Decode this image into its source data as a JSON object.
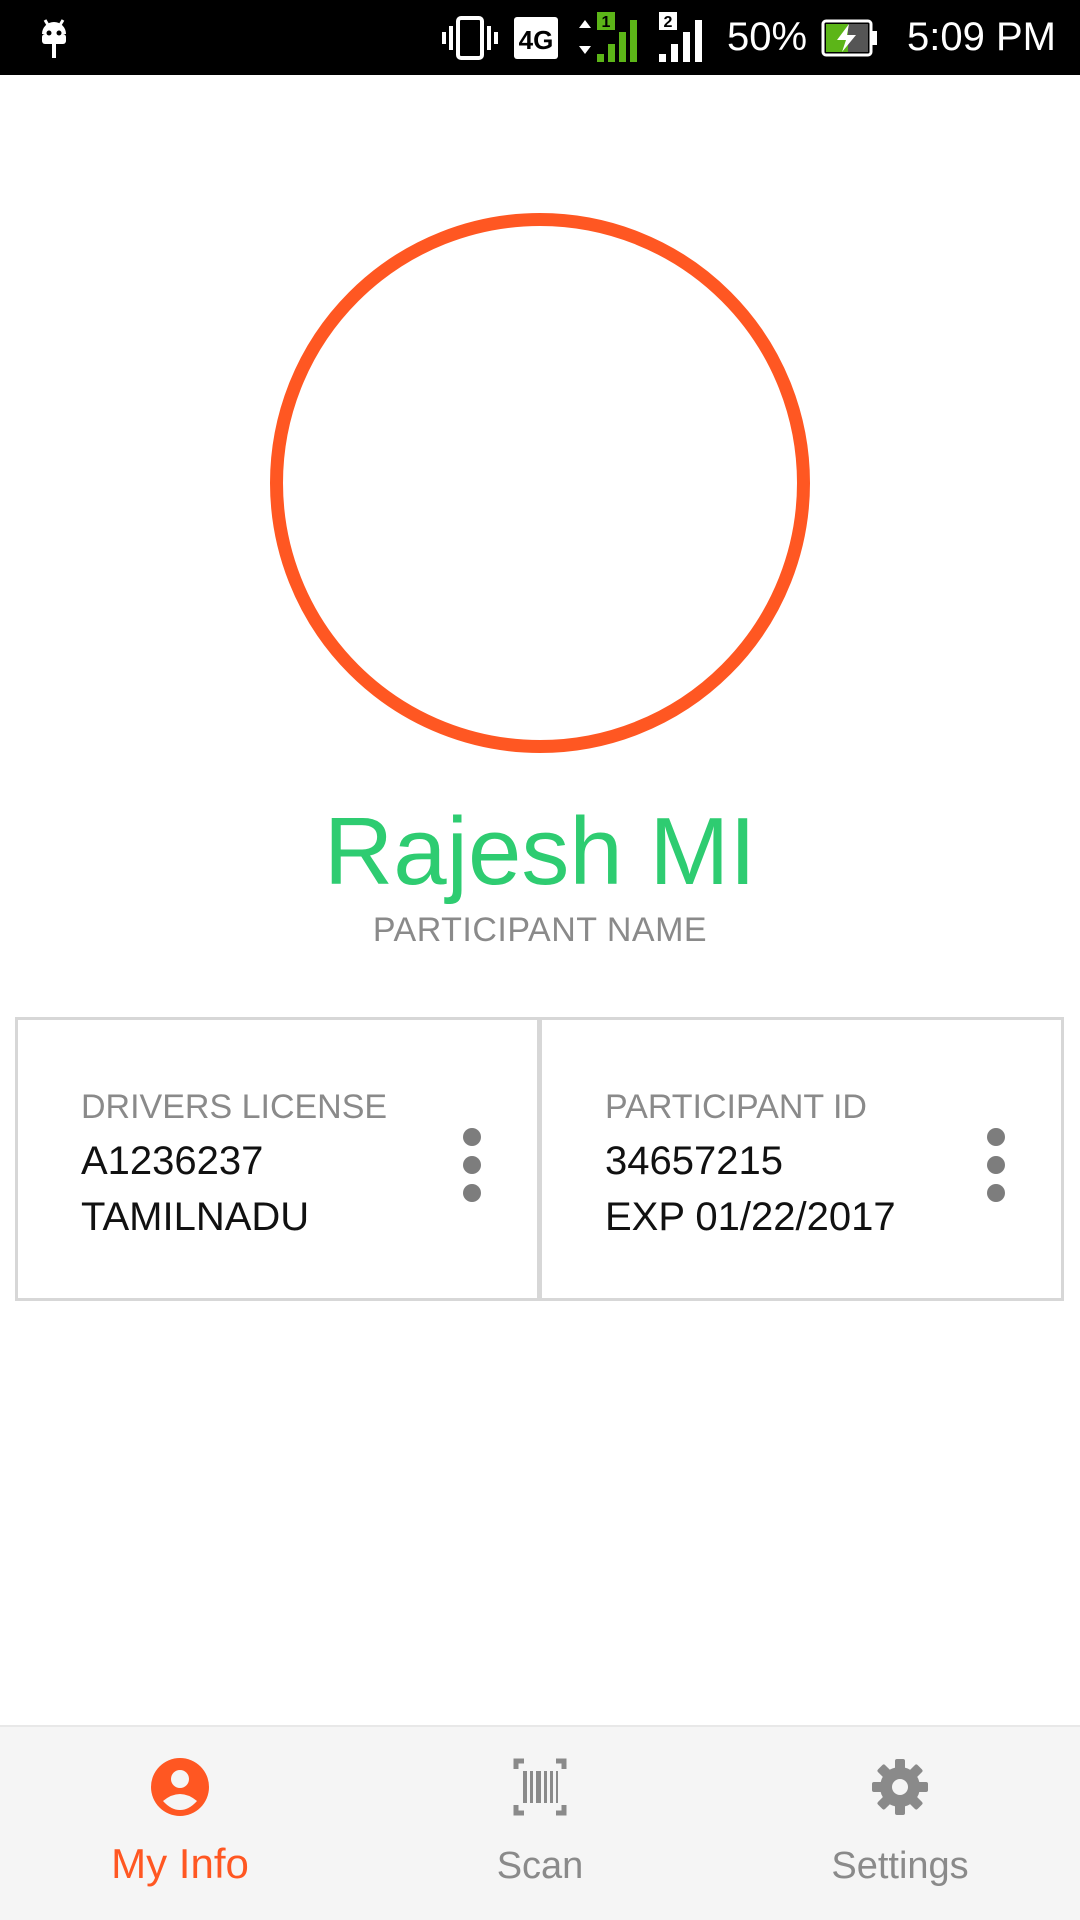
{
  "status_bar": {
    "network": "4G",
    "sim1": "1",
    "sim2": "2",
    "battery": "50%",
    "time": "5:09 PM"
  },
  "profile": {
    "name": "Rajesh MI",
    "name_label": "PARTICIPANT NAME"
  },
  "cards": [
    {
      "label": "DRIVERS LICENSE",
      "line1": "A1236237",
      "line2": "TAMILNADU"
    },
    {
      "label": "PARTICIPANT ID",
      "line1": "34657215",
      "line2": "EXP 01/22/2017"
    }
  ],
  "bottom_nav": {
    "items": [
      {
        "label": "My Info",
        "icon": "account-circle-icon",
        "active": true
      },
      {
        "label": "Scan",
        "icon": "barcode-icon",
        "active": false
      },
      {
        "label": "Settings",
        "icon": "gear-icon",
        "active": false
      }
    ]
  },
  "colors": {
    "accent": "#ff5722",
    "name": "#2ecc71",
    "muted": "#8a8a8a"
  }
}
